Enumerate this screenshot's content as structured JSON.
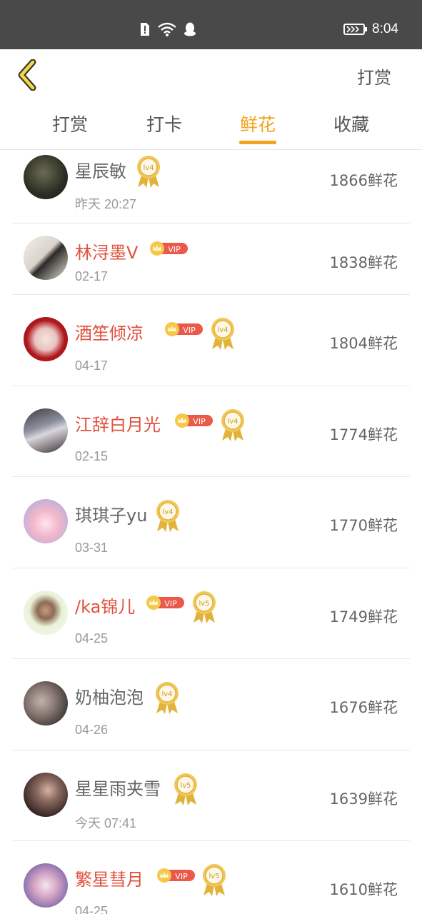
{
  "status_bar": {
    "time": "8:04"
  },
  "header": {
    "action": "打赏",
    "back_icon": "chevron-left-icon"
  },
  "tabs": [
    {
      "label": "打赏",
      "active": false
    },
    {
      "label": "打卡",
      "active": false
    },
    {
      "label": "鲜花",
      "active": true
    },
    {
      "label": "收藏",
      "active": false
    }
  ],
  "list": [
    {
      "name": "星辰敏",
      "date": "昨天 20:27",
      "amount": "1866鲜花",
      "vip": false,
      "level": "lv4"
    },
    {
      "name": "林浔墨V",
      "date": "02-17",
      "amount": "1838鲜花",
      "vip": true,
      "level": ""
    },
    {
      "name": "酒笙倾凉",
      "date": "04-17",
      "amount": "1804鲜花",
      "vip": true,
      "level": "lv4"
    },
    {
      "name": "江辞白月光",
      "date": "02-15",
      "amount": "1774鲜花",
      "vip": true,
      "level": "lv4"
    },
    {
      "name": "琪琪子yu",
      "date": "03-31",
      "amount": "1770鲜花",
      "vip": false,
      "level": "lv4"
    },
    {
      "name": "/ka锦儿",
      "date": "04-25",
      "amount": "1749鲜花",
      "vip": true,
      "level": "lv5"
    },
    {
      "name": "奶柚泡泡",
      "date": "04-26",
      "amount": "1676鲜花",
      "vip": false,
      "level": "lv4"
    },
    {
      "name": "星星雨夹雪",
      "date": "今天 07:41",
      "amount": "1639鲜花",
      "vip": false,
      "level": "lv5"
    },
    {
      "name": "繁星彗月",
      "date": "04-25",
      "amount": "1610鲜花",
      "vip": true,
      "level": "lv5"
    }
  ],
  "vip_label": "VIP",
  "colors": {
    "accent": "#f2a41e",
    "vip_name": "#e0503d",
    "status_bar": "#494949"
  }
}
